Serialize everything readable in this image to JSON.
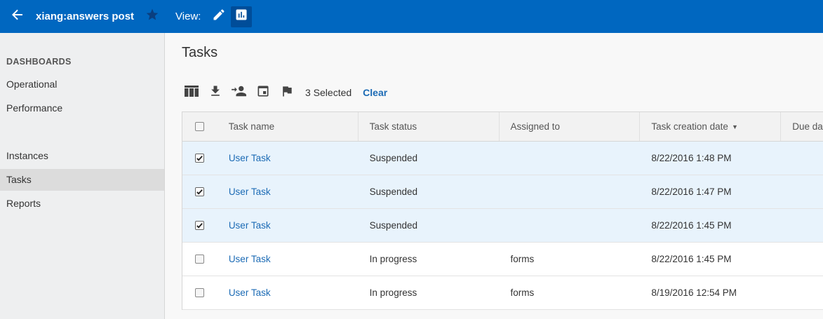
{
  "topbar": {
    "title": "xiang:answers post",
    "view_label": "View:",
    "icons": {
      "back": "arrow-left-icon",
      "favorite": "star-icon",
      "edit": "pencil-icon",
      "report": "bar-chart-icon"
    },
    "colors": {
      "bar": "#0067c0",
      "active_view": "#004d99"
    }
  },
  "sidebar": {
    "heading": "DASHBOARDS",
    "items": [
      {
        "label": "Operational"
      },
      {
        "label": "Performance"
      },
      {
        "label": "Instances"
      },
      {
        "label": "Tasks",
        "active": true
      },
      {
        "label": "Reports"
      }
    ]
  },
  "main": {
    "title": "Tasks",
    "toolbar": {
      "icons": [
        "columns-icon",
        "download-icon",
        "assign-user-icon",
        "calendar-icon",
        "flag-icon"
      ],
      "selected_text": "3 Selected",
      "clear_label": "Clear"
    },
    "table": {
      "columns": [
        "Task name",
        "Task status",
        "Assigned to",
        "Task creation date",
        "Due da"
      ],
      "sorted_column": "Task creation date",
      "sort_direction": "descending",
      "rows": [
        {
          "checked": true,
          "name": "User Task",
          "status": "Suspended",
          "assigned": "",
          "created": "8/22/2016 1:48 PM",
          "due": ""
        },
        {
          "checked": true,
          "name": "User Task",
          "status": "Suspended",
          "assigned": "",
          "created": "8/22/2016 1:47 PM",
          "due": ""
        },
        {
          "checked": true,
          "name": "User Task",
          "status": "Suspended",
          "assigned": "",
          "created": "8/22/2016 1:45 PM",
          "due": ""
        },
        {
          "checked": false,
          "name": "User Task",
          "status": "In progress",
          "assigned": "forms",
          "created": "8/22/2016 1:45 PM",
          "due": ""
        },
        {
          "checked": false,
          "name": "User Task",
          "status": "In progress",
          "assigned": "forms",
          "created": "8/19/2016 12:54 PM",
          "due": ""
        }
      ]
    },
    "colors": {
      "link": "#1c6bb5",
      "selected_row": "#e8f3fc"
    }
  }
}
